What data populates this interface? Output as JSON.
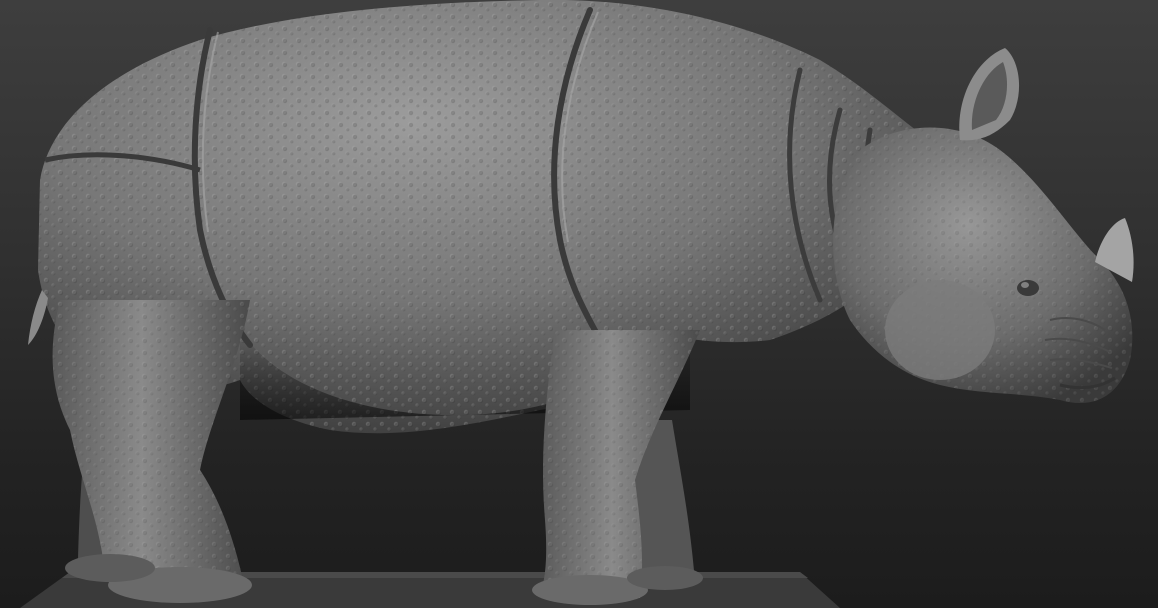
{
  "scene": {
    "subject": "rhinoceros-sculpt",
    "colors": {
      "background_top": "#3e3e3e",
      "background_bottom": "#1c1c1c",
      "clay_light": "#9a9a9a",
      "clay_mid": "#6f6f6f",
      "clay_dark": "#2e2e2e",
      "base_plate": "#3a3a3a"
    },
    "icons": [
      "rhino-figure"
    ]
  }
}
